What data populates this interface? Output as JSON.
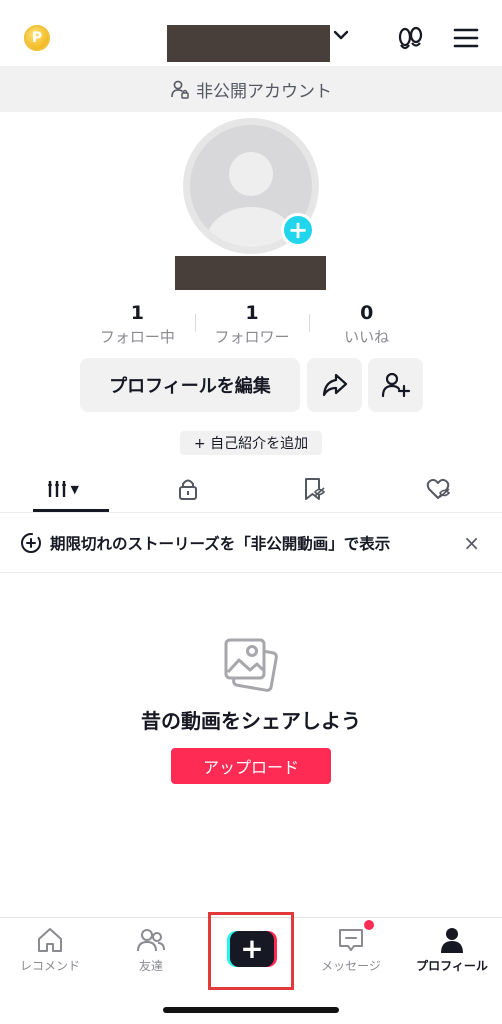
{
  "header": {
    "coin_glyph": "P",
    "private_banner": "非公開アカウント"
  },
  "stats": [
    {
      "value": "1",
      "label": "フォロー中"
    },
    {
      "value": "1",
      "label": "フォロワー"
    },
    {
      "value": "0",
      "label": "いいね"
    }
  ],
  "actions": {
    "edit_profile": "プロフィールを編集",
    "add_bio": "+ 自己紹介を追加"
  },
  "notice": {
    "text": "期限切れのストーリーズを「非公開動画」で表示",
    "close": "×"
  },
  "empty_state": {
    "title": "昔の動画をシェアしよう",
    "upload": "アップロード"
  },
  "bottom_nav": {
    "home": "レコメンド",
    "friends": "友達",
    "create": "+",
    "messages": "メッセージ",
    "profile": "プロフィール"
  },
  "colors": {
    "accent_red": "#fe2c55",
    "accent_cyan": "#25f4ee",
    "dark": "#161823"
  },
  "icons": [
    "coin-icon",
    "chevron-down-icon",
    "footprint-icon",
    "menu-icon",
    "lock-user-icon",
    "share-icon",
    "add-friend-icon",
    "videos-grid-icon",
    "lock-icon",
    "bookmark-icon",
    "heart-icon",
    "story-icon",
    "photo-icon",
    "home-icon",
    "friends-icon",
    "message-icon",
    "profile-icon"
  ]
}
